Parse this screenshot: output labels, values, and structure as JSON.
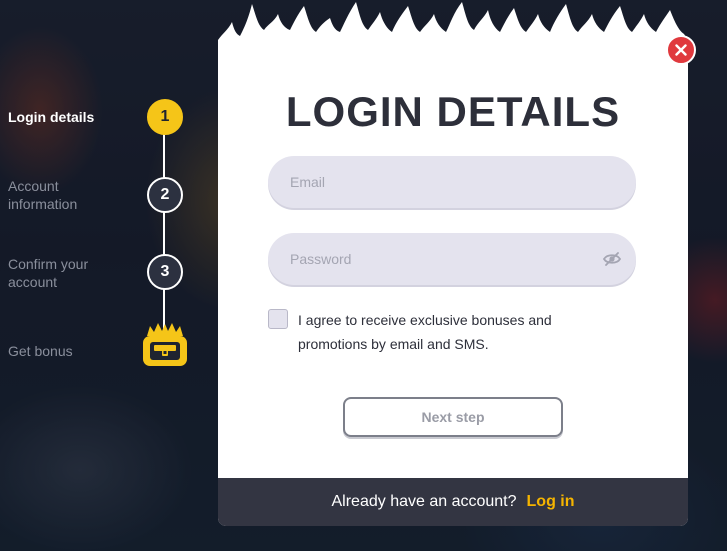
{
  "steps": [
    {
      "label": "Login details",
      "number": "1",
      "active": true
    },
    {
      "label": "Account information",
      "number": "2",
      "active": false
    },
    {
      "label": "Confirm your account",
      "number": "3",
      "active": false
    },
    {
      "label": "Get bonus",
      "icon": "treasure-chest-icon",
      "active": false
    }
  ],
  "modal": {
    "title": "LOGIN DETAILS",
    "email_placeholder": "Email",
    "password_placeholder": "Password",
    "consent_text": "I agree to receive exclusive bonuses and promotions by email and SMS.",
    "consent_checked": false,
    "next_label": "Next step",
    "footer_text": "Already have an account?",
    "login_link": "Log in"
  },
  "colors": {
    "accent": "#f5c518",
    "close": "#e0393e",
    "link": "#f5b400",
    "footer_bg": "#333542"
  }
}
